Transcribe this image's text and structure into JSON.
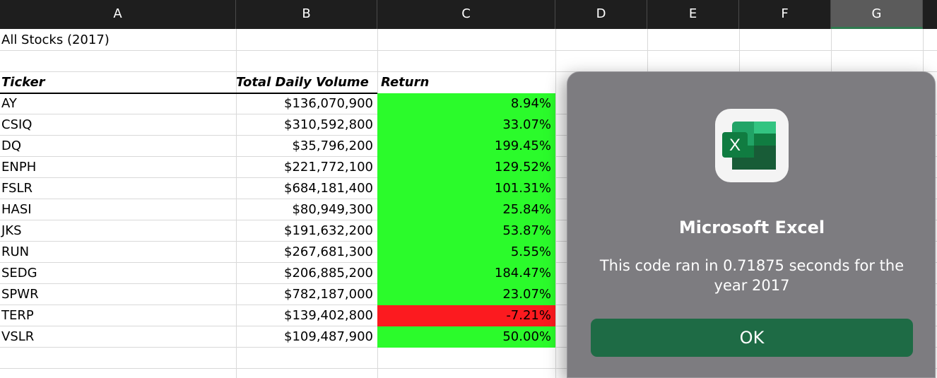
{
  "columns": [
    "A",
    "B",
    "C",
    "D",
    "E",
    "F",
    "G"
  ],
  "sheet": {
    "title": "All Stocks (2017)",
    "headers": {
      "ticker": "Ticker",
      "volume": "Total Daily Volume",
      "return": "Return"
    },
    "rows": [
      {
        "ticker": "AY",
        "volume": "$136,070,900",
        "return": "8.94%",
        "positive": true
      },
      {
        "ticker": "CSIQ",
        "volume": "$310,592,800",
        "return": "33.07%",
        "positive": true
      },
      {
        "ticker": "DQ",
        "volume": "$35,796,200",
        "return": "199.45%",
        "positive": true
      },
      {
        "ticker": "ENPH",
        "volume": "$221,772,100",
        "return": "129.52%",
        "positive": true
      },
      {
        "ticker": "FSLR",
        "volume": "$684,181,400",
        "return": "101.31%",
        "positive": true
      },
      {
        "ticker": "HASI",
        "volume": "$80,949,300",
        "return": "25.84%",
        "positive": true
      },
      {
        "ticker": "JKS",
        "volume": "$191,632,200",
        "return": "53.87%",
        "positive": true
      },
      {
        "ticker": "RUN",
        "volume": "$267,681,300",
        "return": "5.55%",
        "positive": true
      },
      {
        "ticker": "SEDG",
        "volume": "$206,885,200",
        "return": "184.47%",
        "positive": true
      },
      {
        "ticker": "SPWR",
        "volume": "$782,187,000",
        "return": "23.07%",
        "positive": true
      },
      {
        "ticker": "TERP",
        "volume": "$139,402,800",
        "return": "-7.21%",
        "positive": false
      },
      {
        "ticker": "VSLR",
        "volume": "$109,487,900",
        "return": "50.00%",
        "positive": true
      }
    ]
  },
  "colors": {
    "positive": "#2bfb2b",
    "negative": "#fc1a1f"
  },
  "dialog": {
    "app_icon": "excel-icon",
    "icon_letter": "X",
    "title": "Microsoft Excel",
    "message": "This code ran in 0.71875 seconds for the year 2017",
    "ok_label": "OK"
  }
}
